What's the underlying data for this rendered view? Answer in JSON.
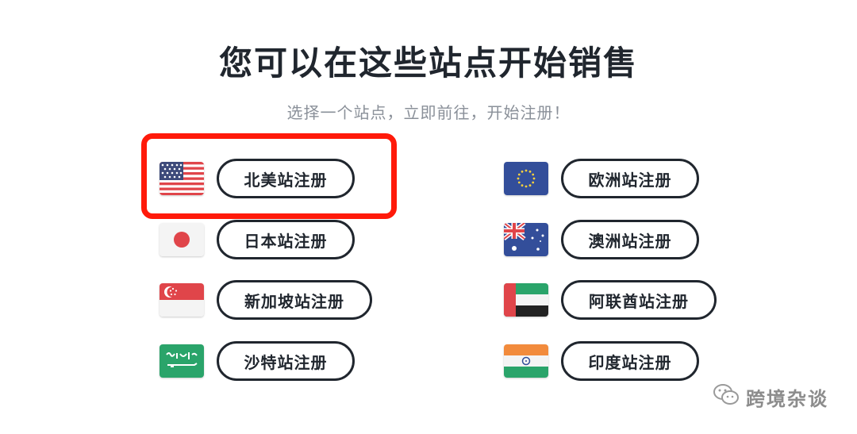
{
  "header": {
    "title": "您可以在这些站点开始销售",
    "subtitle": "选择一个站点，立即前往，开始注册！"
  },
  "sites": {
    "na": {
      "label": "北美站注册",
      "flag": "us-flag-icon"
    },
    "jp": {
      "label": "日本站注册",
      "flag": "japan-flag-icon"
    },
    "sg": {
      "label": "新加坡站注册",
      "flag": "singapore-flag-icon"
    },
    "sa": {
      "label": "沙特站注册",
      "flag": "saudi-flag-icon"
    },
    "eu": {
      "label": "欧洲站注册",
      "flag": "eu-flag-icon"
    },
    "au": {
      "label": "澳洲站注册",
      "flag": "australia-flag-icon"
    },
    "ae": {
      "label": "阿联酋站注册",
      "flag": "uae-flag-icon"
    },
    "in": {
      "label": "印度站注册",
      "flag": "india-flag-icon"
    }
  },
  "watermark": {
    "text": "跨境杂谈",
    "icon": "wechat-icon"
  },
  "colors": {
    "text": "#20262e",
    "subtitle": "#8a9099",
    "highlight": "#ff1a0a"
  }
}
